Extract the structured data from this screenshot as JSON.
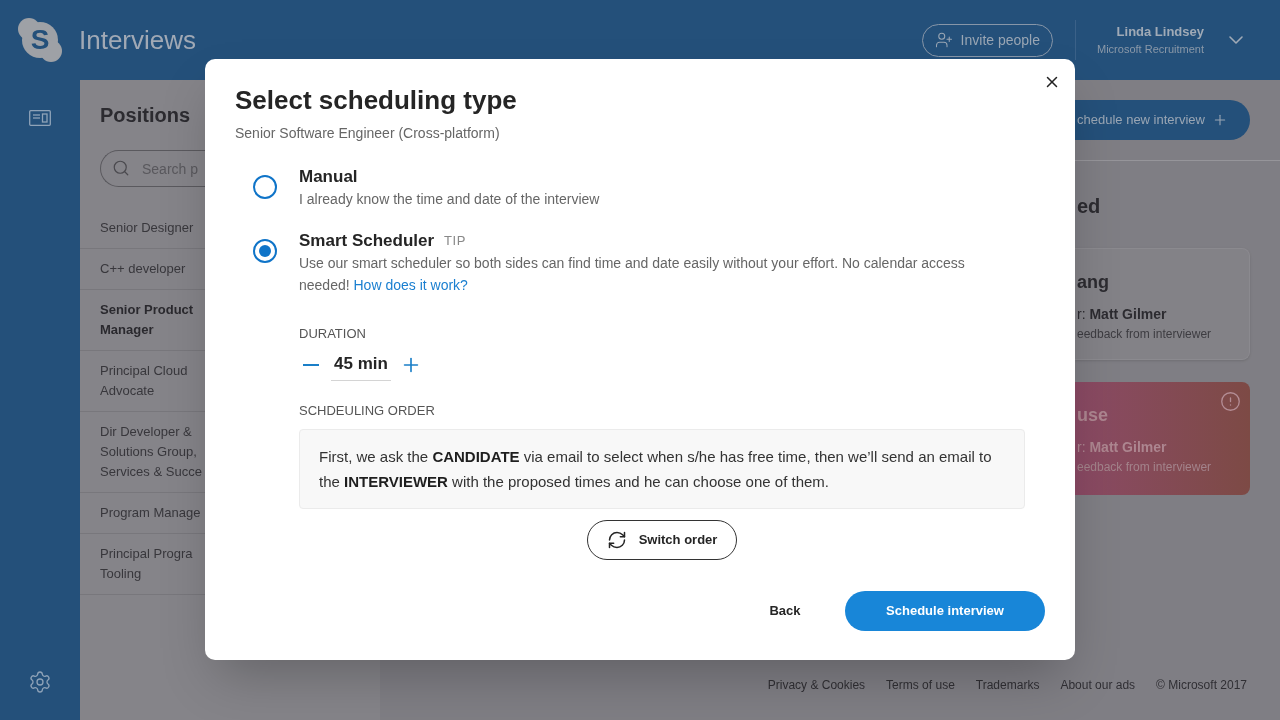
{
  "header": {
    "logo_letter": "S",
    "app_title": "Interviews",
    "invite_button": "Invite people",
    "user": {
      "name": "Linda Lindsey",
      "organization": "Microsoft Recruitment"
    }
  },
  "positions": {
    "title": "Positions",
    "search": {
      "placeholder": "Search p"
    },
    "items": [
      {
        "lines": [
          "Senior Designer"
        ],
        "selected": false
      },
      {
        "lines": [
          "C++ developer"
        ],
        "selected": false
      },
      {
        "lines": [
          "Senior Product",
          "Manager"
        ],
        "selected": true
      },
      {
        "lines": [
          "Principal Cloud",
          "Advocate"
        ],
        "selected": false
      },
      {
        "lines": [
          "Dir Developer &",
          "Solutions Group,",
          "Services & Succe"
        ],
        "selected": false
      },
      {
        "lines": [
          "Program Manage"
        ],
        "selected": false
      },
      {
        "lines": [
          "Principal Progra",
          "Tooling"
        ],
        "selected": false
      }
    ]
  },
  "main": {
    "new_interview_button": "chedule new interview",
    "section_heading": "ed",
    "cards": [
      {
        "kind": "normal",
        "name": "ang",
        "interviewer": "r: **Matt Gilmer**",
        "status": "eedback from interviewer"
      },
      {
        "kind": "alert",
        "name": "use",
        "interviewer": "r: **Matt Gilmer**",
        "status": "eedback from interviewer"
      }
    ]
  },
  "footer": {
    "links": [
      "Privacy & Cookies",
      "Terms of use",
      "Trademarks",
      "About our ads",
      "© Microsoft 2017"
    ]
  },
  "dialog": {
    "title": "Select scheduling type",
    "subtitle": "Senior Software Engineer (Cross-platform)",
    "options": [
      {
        "label": "Manual",
        "description": "I already know the time and date of the interview",
        "selected": false
      },
      {
        "label": "Smart Scheduler",
        "badge": "TIP",
        "description": "Use our smart scheduler so both sides can find time and date easily without your effort. No calendar access needed!",
        "link": "How does it work?",
        "selected": true
      }
    ],
    "duration": {
      "label": "DURATION",
      "value": "45 min"
    },
    "order": {
      "label": "SCHDEULING ORDER",
      "text": "First, we ask the **CANDIDATE** via email to select when s/he has free time, then we’ll send an email to the **INTERVIEWER** with the proposed times and he can choose one of them.",
      "button": "Switch order"
    },
    "buttons": [
      {
        "kind": "text",
        "label": "Back"
      },
      {
        "kind": "primary",
        "label": "Schedule interview"
      }
    ]
  }
}
